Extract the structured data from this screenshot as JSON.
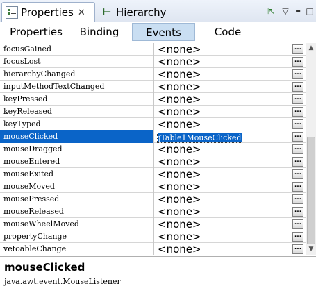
{
  "view_tabs": [
    {
      "label": "Properties",
      "icon": "properties-icon",
      "closable": true
    },
    {
      "label": "Hierarchy",
      "icon": "hierarchy-icon"
    }
  ],
  "toolbar": {
    "pin_icon": "pin-icon",
    "menu_icon": "view-menu-icon",
    "minimize_icon": "minimize-icon",
    "maximize_icon": "maximize-icon",
    "close_symbol": "✕",
    "pin_symbol": "⇱",
    "menu_symbol": "▽",
    "minimize_symbol": "▬",
    "maximize_symbol": "□"
  },
  "sub_tabs": [
    "Properties",
    "Binding",
    "Events",
    "Code"
  ],
  "selected_sub_tab": "Events",
  "events": [
    {
      "name": "focusGained",
      "value": "<none>"
    },
    {
      "name": "focusLost",
      "value": "<none>"
    },
    {
      "name": "hierarchyChanged",
      "value": "<none>"
    },
    {
      "name": "inputMethodTextChanged",
      "value": "<none>"
    },
    {
      "name": "keyPressed",
      "value": "<none>"
    },
    {
      "name": "keyReleased",
      "value": "<none>"
    },
    {
      "name": "keyTyped",
      "value": "<none>"
    },
    {
      "name": "mouseClicked",
      "value": "jTable1MouseClicked",
      "selected": true
    },
    {
      "name": "mouseDragged",
      "value": "<none>"
    },
    {
      "name": "mouseEntered",
      "value": "<none>"
    },
    {
      "name": "mouseExited",
      "value": "<none>"
    },
    {
      "name": "mouseMoved",
      "value": "<none>"
    },
    {
      "name": "mousePressed",
      "value": "<none>"
    },
    {
      "name": "mouseReleased",
      "value": "<none>"
    },
    {
      "name": "mouseWheelMoved",
      "value": "<none>"
    },
    {
      "name": "propertyChange",
      "value": "<none>"
    },
    {
      "name": "vetoableChange",
      "value": "<none>"
    }
  ],
  "ellipsis_label": "...",
  "description": {
    "title": "mouseClicked",
    "text": "java.awt.event.MouseListener"
  },
  "colors": {
    "selection": "#0a64c8",
    "selected_tab": "#c9def2"
  }
}
